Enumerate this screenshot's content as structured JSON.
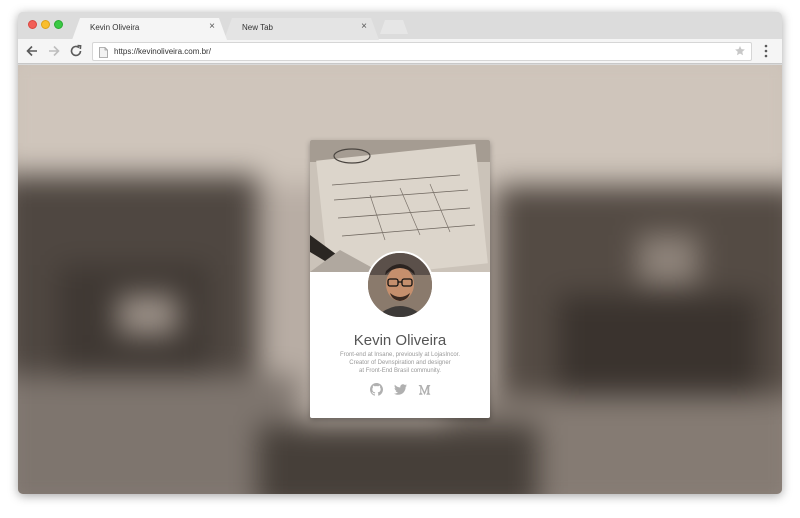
{
  "browser": {
    "tabs": [
      {
        "title": "Kevin Oliveira",
        "active": true
      },
      {
        "title": "New Tab",
        "active": false
      }
    ],
    "tab_close_glyph": "×",
    "url": "https://kevinoliveira.com.br/"
  },
  "profile": {
    "name": "Kevin Oliveira",
    "bio_lines": [
      "Front-end at Insane, previously at LojasIncor.",
      "Creator of Devnspiration and designer",
      "at Front-End Brasil community."
    ],
    "social_icons": [
      "github-icon",
      "twitter-icon",
      "medium-icon"
    ],
    "medium_glyph": "M"
  },
  "colors": {
    "traffic_red": "#f25f58",
    "traffic_yellow": "#f9be2e",
    "traffic_green": "#3ac943",
    "name_text": "#555555",
    "bio_text": "#999999",
    "social_icon": "#b0b0b0"
  }
}
